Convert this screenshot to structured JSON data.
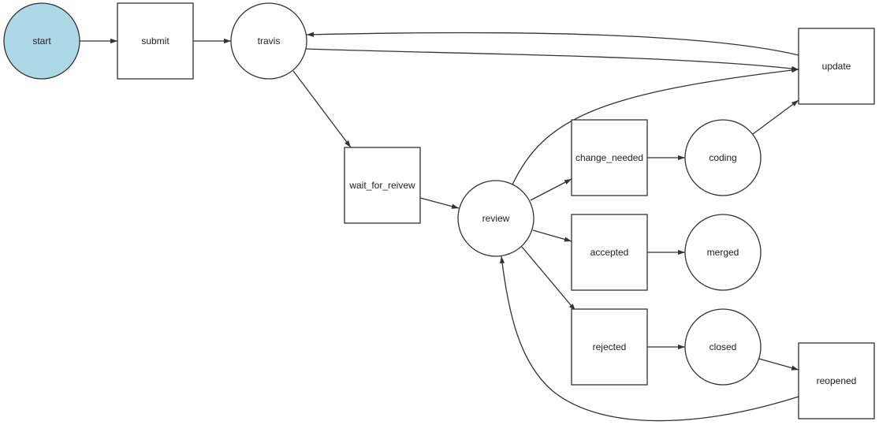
{
  "diagram": {
    "type": "state-graph",
    "style": {
      "start_fill": "#add8e6",
      "node_fill": "#ffffff",
      "stroke": "#333333"
    },
    "nodes": [
      {
        "id": "start",
        "label": "start",
        "shape": "circle"
      },
      {
        "id": "submit",
        "label": "submit",
        "shape": "box"
      },
      {
        "id": "travis",
        "label": "travis",
        "shape": "circle"
      },
      {
        "id": "update",
        "label": "update",
        "shape": "box"
      },
      {
        "id": "wait_for_reivew",
        "label": "wait_for_reivew",
        "shape": "box"
      },
      {
        "id": "review",
        "label": "review",
        "shape": "circle"
      },
      {
        "id": "change_needed",
        "label": "change_needed",
        "shape": "box"
      },
      {
        "id": "coding",
        "label": "coding",
        "shape": "circle"
      },
      {
        "id": "accepted",
        "label": "accepted",
        "shape": "box"
      },
      {
        "id": "merged",
        "label": "merged",
        "shape": "circle"
      },
      {
        "id": "rejected",
        "label": "rejected",
        "shape": "box"
      },
      {
        "id": "closed",
        "label": "closed",
        "shape": "circle"
      },
      {
        "id": "reopened",
        "label": "reopened",
        "shape": "box"
      }
    ],
    "edges": [
      {
        "from": "start",
        "to": "submit"
      },
      {
        "from": "submit",
        "to": "travis"
      },
      {
        "from": "travis",
        "to": "update"
      },
      {
        "from": "update",
        "to": "travis"
      },
      {
        "from": "travis",
        "to": "wait_for_reivew"
      },
      {
        "from": "wait_for_reivew",
        "to": "review"
      },
      {
        "from": "review",
        "to": "update"
      },
      {
        "from": "review",
        "to": "change_needed"
      },
      {
        "from": "review",
        "to": "accepted"
      },
      {
        "from": "review",
        "to": "rejected"
      },
      {
        "from": "change_needed",
        "to": "coding"
      },
      {
        "from": "coding",
        "to": "update"
      },
      {
        "from": "accepted",
        "to": "merged"
      },
      {
        "from": "rejected",
        "to": "closed"
      },
      {
        "from": "closed",
        "to": "reopened"
      },
      {
        "from": "reopened",
        "to": "review"
      }
    ]
  }
}
